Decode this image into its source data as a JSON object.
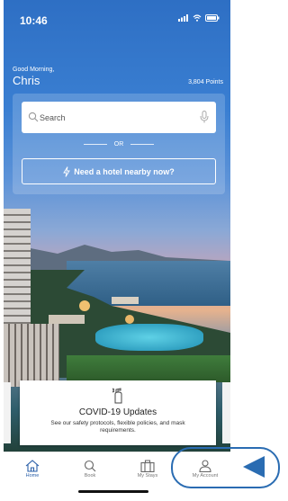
{
  "status_bar": {
    "time": "10:46"
  },
  "header": {
    "greeting": "Good Morning,",
    "name": "Chris",
    "points": "3,804 Points"
  },
  "search": {
    "placeholder": "Search"
  },
  "divider": {
    "text": "OR"
  },
  "nearby_button": {
    "label": "Need a hotel nearby now?"
  },
  "covid_card": {
    "title": "COVID-19 Updates",
    "description": "See our safety protocols, flexible policies, and mask requirements."
  },
  "tabs": [
    {
      "label": "Home",
      "icon": "home-icon",
      "active": true
    },
    {
      "label": "Book",
      "icon": "search-icon",
      "active": false
    },
    {
      "label": "My Stays",
      "icon": "suitcase-icon",
      "active": false
    },
    {
      "label": "My Account",
      "icon": "person-icon",
      "active": false
    }
  ],
  "colors": {
    "accent": "#2a6cb2",
    "active_tab": "#2a5fa8"
  }
}
